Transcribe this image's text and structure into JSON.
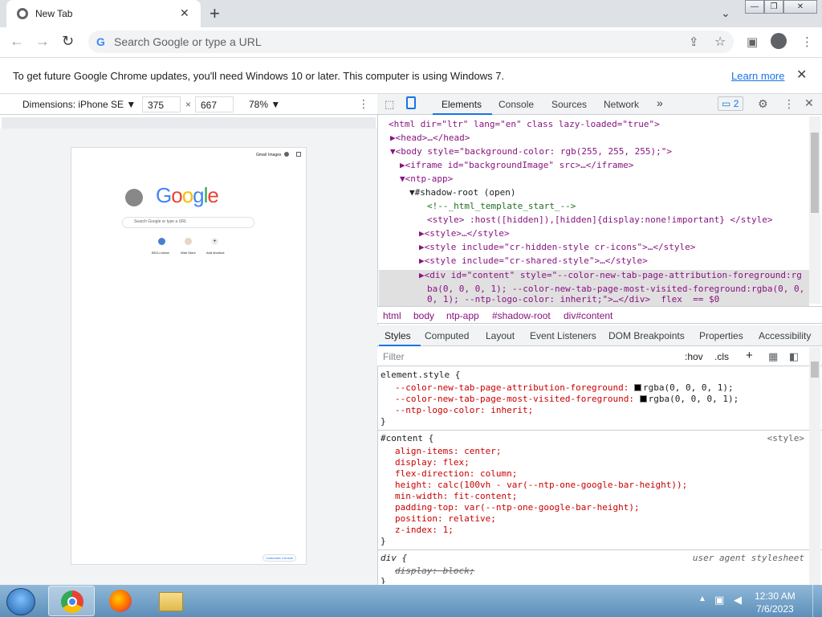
{
  "browser": {
    "tab_title": "New Tab",
    "tab_close": "✕",
    "new_tab": "+",
    "tab_search": "⌄",
    "window_controls": [
      "—",
      "❐",
      "✕"
    ]
  },
  "toolbar": {
    "omnibox_placeholder": "Search Google or type a URL",
    "back": "←",
    "forward": "→",
    "reload": "↻",
    "share": "⇪",
    "bookmark": "☆",
    "sidepanel": "▣",
    "menu": "⋮"
  },
  "infobar": {
    "message": "To get future Google Chrome updates, you'll need Windows 10 or later. This computer is using Windows 7.",
    "link": "Learn more",
    "close": "✕"
  },
  "device_toolbar": {
    "dimensions": "Dimensions: iPhone SE ▼",
    "width": "375",
    "times": "×",
    "height": "667",
    "zoom": "78% ▼",
    "more": "⋮"
  },
  "emulated_page": {
    "header_links": [
      "Gmail",
      "Images"
    ],
    "logo": "Google",
    "search_placeholder": "Search Google or type a URL",
    "shortcuts": [
      "BDCu entan",
      "Web Store",
      "Add shortcut"
    ],
    "customize": "Customize Chrome"
  },
  "devtools": {
    "tabs": [
      "Elements",
      "Console",
      "Sources",
      "Network"
    ],
    "overflow": "»",
    "issues_count": "2",
    "dom_lines": [
      "<html dir=\"ltr\" lang=\"en\" class lazy-loaded=\"true\">",
      "▶<head>…</head>",
      "▼<body style=\"background-color: rgb(255, 255, 255);\">",
      "▶<iframe id=\"backgroundImage\" src>…</iframe>",
      "▼<ntp-app>",
      "▼#shadow-root (open)",
      "<!--_html_template_start_-->",
      "<style> :host([hidden]),[hidden]{display:none!important} </style>",
      "▶<style>…</style>",
      "▶<style include=\"cr-hidden-style cr-icons\">…</style>",
      "▶<style include=\"cr-shared-style\">…</style>",
      "▶<div id=\"content\" style=\"--color-new-tab-page-attribution-foreground:rg",
      "ba(0, 0, 0, 1); --color-new-tab-page-most-visited-foreground:rgba(0, 0,",
      "0, 1); --ntp-logo-color: inherit;\">…</div>  flex  == $0"
    ],
    "breadcrumbs": [
      "html",
      "body",
      "ntp-app",
      "#shadow-root",
      "div#content"
    ],
    "style_tabs": [
      "Styles",
      "Computed",
      "Layout",
      "Event Listeners",
      "DOM Breakpoints",
      "Properties",
      "Accessibility"
    ],
    "filter_placeholder": "Filter",
    "filter_tools": [
      ":hov",
      ".cls",
      "+"
    ],
    "element_style": {
      "selector": "element.style {",
      "props": [
        "--color-new-tab-page-attribution-foreground: ",
        "--color-new-tab-page-most-visited-foreground: ",
        "--ntp-logo-color: inherit;"
      ],
      "values": [
        "rgba(0, 0, 0, 1);",
        "rgba(0, 0, 0, 1);"
      ],
      "close": "}"
    },
    "content_rule": {
      "selector": "#content {",
      "source": "<style>",
      "lines": [
        "align-items: center;",
        "display: flex;",
        "flex-direction: column;",
        "height: calc(100vh - var(--ntp-one-google-bar-height));",
        "min-width: fit-content;",
        "padding-top: var(--ntp-one-google-bar-height);",
        "position: relative;",
        "z-index: 1;"
      ],
      "close": "}"
    },
    "div_rule": {
      "selector": "div {",
      "source": "user agent stylesheet",
      "line": "display: block;",
      "close": "}"
    }
  },
  "taskbar": {
    "time": "12:30 AM",
    "date": "7/6/2023"
  }
}
